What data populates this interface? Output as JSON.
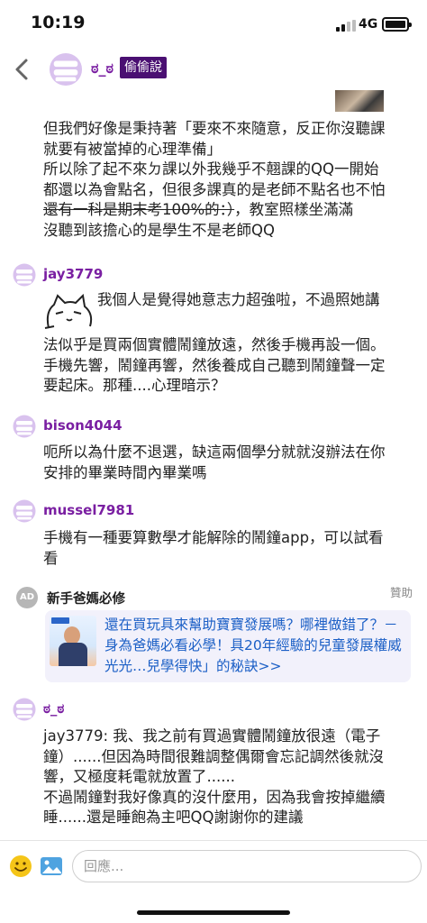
{
  "status_bar": {
    "time": "10:19",
    "network": "4G"
  },
  "nav": {
    "author": "ಠ_ಠ",
    "badge": "偷偷說"
  },
  "messages": [
    {
      "lines": [
        "但我們好像是秉持著「要來不來隨意，反正你沒聽課",
        "就要有被當掉的心理準備」",
        "所以除了起不來ㄉ課以外我幾乎不翹課的QQ一開始",
        "都還以為會點名，但很多課真的是老師不點名也不怕"
      ],
      "strike": "還有一科是期末考100%的：）",
      "after_strike": "，教室照樣坐滿滿",
      "last_line": "沒聽到該擔心的是學生不是老師QQ"
    },
    {
      "author": "jay3779",
      "first_line": "我個人是覺得她意志力超強啦，不過照她講",
      "text": "法似乎是買兩個實體鬧鐘放遠，然後手機再設一個。\n手機先響，鬧鐘再響，然後養成自己聽到鬧鐘聲一定\n要起床。那種....心理暗示？"
    },
    {
      "author": "bison4044",
      "text": "呃所以為什麼不退選，缺這兩個學分就就沒辦法在你\n安排的畢業時間內畢業嗎"
    },
    {
      "author": "mussel7981",
      "text": "手機有一種要算數學才能解除的鬧鐘app，可以試看\n看"
    },
    {
      "author": "ಠ_ಠ",
      "text": "jay3779: 我、我之前有買過實體鬧鐘放很遠（電子\n鐘）......但因為時間很難調整偶爾會忘記調然後就沒\n響，又極度耗電就放置了......\n不過鬧鐘對我好像真的沒什麼用，因為我會按掉繼續\n睡......還是睡飽為主吧QQ謝謝你的建議"
    }
  ],
  "ad": {
    "logo": "AD",
    "name": "新手爸媽必修",
    "sponsored": "贊助",
    "text": "還在買玩具來幫助寶寶發展嗎？哪裡做錯了？－身為爸媽必看必學！具20年經驗的兒童發展權威光光…兒學得快」的秘訣>>"
  },
  "reply": {
    "placeholder": "回應..."
  },
  "colors": {
    "author": "#7a1fa2",
    "badge_bg": "#4a0f72",
    "ad_link": "#1b5fc6",
    "ad_card_bg": "#f2f1fb"
  }
}
